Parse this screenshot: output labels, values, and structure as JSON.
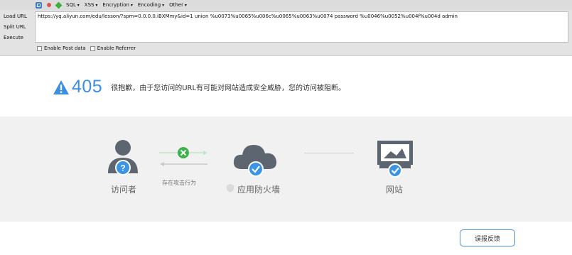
{
  "hackbar": {
    "menu": {
      "sql": "SQL",
      "xss": "XSS",
      "encryption": "Encryption",
      "encoding": "Encoding",
      "other": "Other"
    },
    "buttons": {
      "load_url": "Load URL",
      "split_url": "Split URL",
      "execute": "Execute"
    },
    "url_value": "https://yq.aliyun.com/edu/lesson/?spm=0.0.0.0.iBXMmy&id=1 union %u0073%u0065%u006c%u0065%u0063%u0074 password %u0046%u0052%u004f%u004d admin",
    "options": {
      "post_data": "Enable Post data",
      "referrer": "Enable Referrer"
    }
  },
  "error": {
    "code": "405",
    "message": "很抱歉，由于您访问的URL有可能对网站造成安全威胁，您的访问被阻断。",
    "accent_color": "#3a8ee6"
  },
  "flow": {
    "visitor_label": "访问者",
    "attack_label": "存在攻击行为",
    "firewall_label": "应用防火墙",
    "site_label": "网站",
    "icons": [
      "user-question-icon",
      "blocked-x-icon",
      "cloud-check-icon",
      "monitor-check-icon",
      "shield-icon"
    ]
  },
  "feedback": {
    "label": "误报反馈"
  }
}
